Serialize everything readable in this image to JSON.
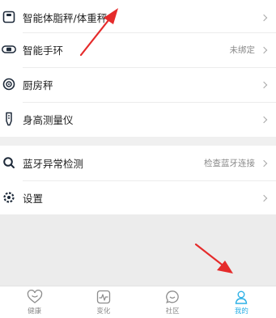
{
  "menu": {
    "items": [
      {
        "label": "智能体脂秤/体重秤",
        "value": "",
        "icon": "scale-icon"
      },
      {
        "label": "智能手环",
        "value": "未绑定",
        "icon": "band-icon"
      },
      {
        "label": "厨房秤",
        "value": "",
        "icon": "kitchen-scale-icon"
      },
      {
        "label": "身高测量仪",
        "value": "",
        "icon": "height-meter-icon"
      },
      {
        "label": "蓝牙异常检测",
        "value": "检查蓝牙连接",
        "icon": "search-icon"
      },
      {
        "label": "设置",
        "value": "",
        "icon": "gear-icon"
      }
    ]
  },
  "tabbar": {
    "tabs": [
      {
        "label": "健康",
        "icon": "heart-icon",
        "active": false
      },
      {
        "label": "变化",
        "icon": "pulse-icon",
        "active": false
      },
      {
        "label": "社区",
        "icon": "chat-icon",
        "active": false
      },
      {
        "label": "我的",
        "icon": "person-icon",
        "active": true
      }
    ]
  },
  "colors": {
    "accent": "#2bb0e6",
    "annotation_arrow": "#e52b2b",
    "icon": "#1e2a3a"
  }
}
